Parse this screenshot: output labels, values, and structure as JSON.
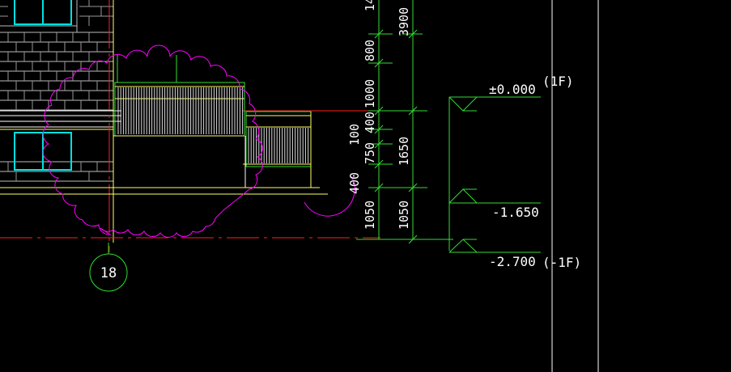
{
  "drawing": {
    "dim_labels_left": [
      "100",
      "750",
      "400",
      "400",
      "1050"
    ],
    "dim_labels_right": [
      "3900",
      "1000",
      "1650",
      "1050"
    ],
    "dim_label_top_partial": "14",
    "dim_label_800": "800",
    "dim_label_1000": "1000",
    "levels": [
      {
        "value": "±0.000",
        "floor": "(1F)"
      },
      {
        "value": "-1.650",
        "floor": ""
      },
      {
        "value": "-2.700",
        "floor": "(-1F)"
      }
    ],
    "grid_axis_label": "18"
  },
  "colors": {
    "background": "#000000",
    "dimension_green": "#33dd33",
    "revision_cloud": "#ff00ff",
    "wall": "#ffffff",
    "ground_line": "#ffff66",
    "red_line": "#ff2020",
    "window_cyan": "#00e0e0",
    "railing_white": "#dddddd"
  }
}
